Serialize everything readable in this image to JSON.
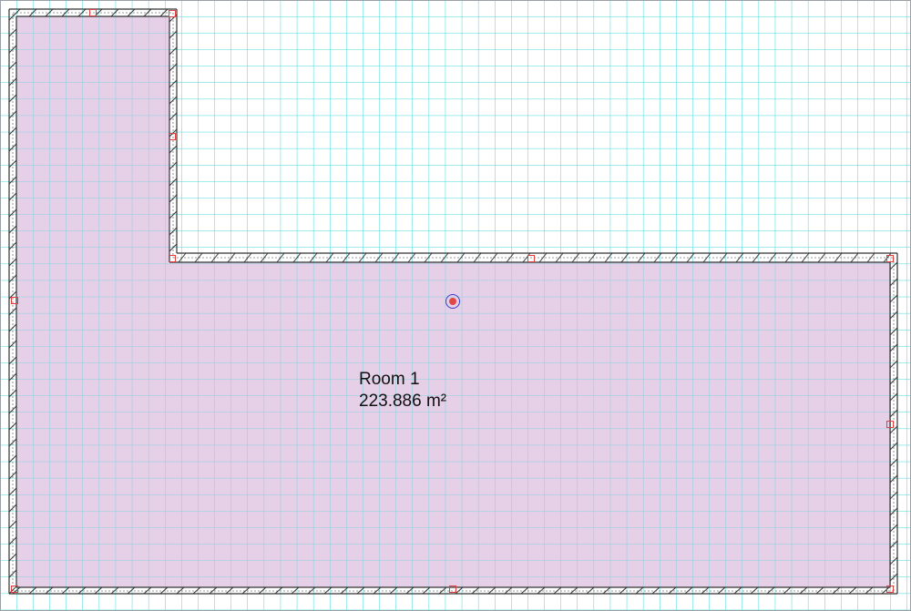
{
  "room": {
    "name": "Room 1",
    "area": "223.886 m²"
  },
  "colors": {
    "grid": "#3fd7dc",
    "floor": "#e5cce6",
    "wall_line": "#333333",
    "handle": "#e04040",
    "center_marker": "#3a3ad0"
  }
}
